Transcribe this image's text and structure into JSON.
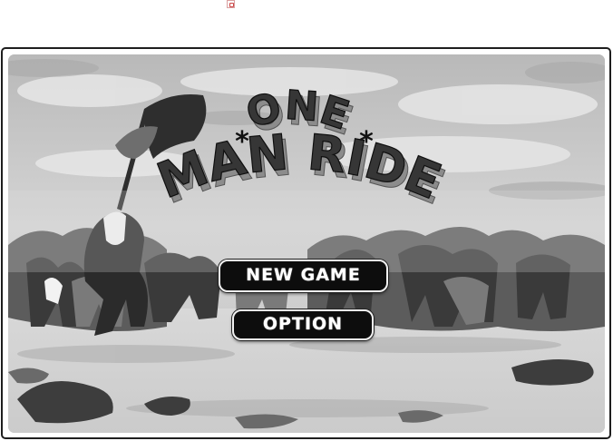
{
  "game": {
    "title_line1": "ONE",
    "title_line2": "MAN RIDE",
    "star": "*",
    "menu": {
      "new_game_label": "NEW GAME",
      "option_label": "OPTION"
    }
  },
  "icons": {
    "broken_image": "broken-image-icon"
  },
  "colors": {
    "button_bg": "#0d0d0d",
    "button_text": "#ffffff",
    "frame_border": "#1e1e1e",
    "title_fill": "#3a3a3a"
  }
}
